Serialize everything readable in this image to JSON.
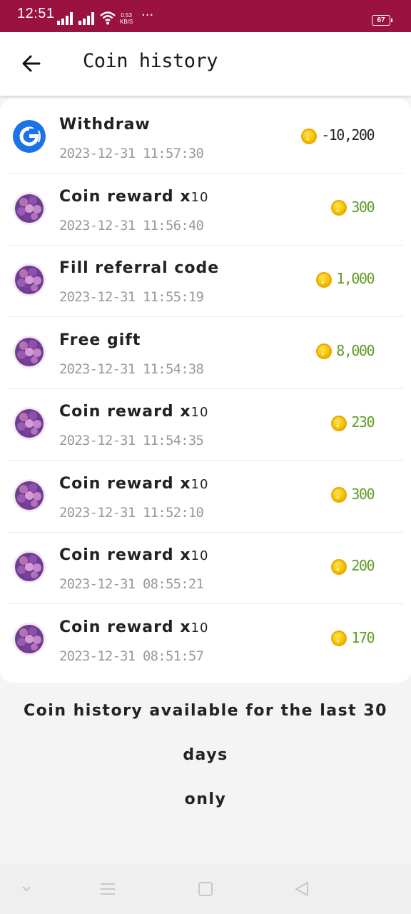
{
  "status_bar": {
    "time": "12:51",
    "net_speed_value": "0.53",
    "net_speed_unit": "KB/S",
    "more": "···",
    "battery": "67"
  },
  "header": {
    "title": "Coin history",
    "back_icon": "arrow-left-icon"
  },
  "items": [
    {
      "title": "Withdraw",
      "suffix": "",
      "date": "2023-12-31  11:57:30",
      "amount": "-10,200",
      "type": "neg",
      "icon": "google-pay-logo"
    },
    {
      "title": "Coin reward x",
      "suffix": "10",
      "date": "2023-12-31  11:56:40",
      "amount": "300",
      "type": "pos",
      "icon": "game-avatar"
    },
    {
      "title": "Fill referral code",
      "suffix": "",
      "date": "2023-12-31  11:55:19",
      "amount": "1,000",
      "type": "pos",
      "icon": "game-avatar"
    },
    {
      "title": "Free gift",
      "suffix": "",
      "date": "2023-12-31  11:54:38",
      "amount": "8,000",
      "type": "pos",
      "icon": "game-avatar"
    },
    {
      "title": "Coin reward x",
      "suffix": "10",
      "date": "2023-12-31  11:54:35",
      "amount": "230",
      "type": "pos",
      "icon": "game-avatar"
    },
    {
      "title": "Coin reward x",
      "suffix": "10",
      "date": "2023-12-31  11:52:10",
      "amount": "300",
      "type": "pos",
      "icon": "game-avatar"
    },
    {
      "title": "Coin reward x",
      "suffix": "10",
      "date": "2023-12-31  08:55:21",
      "amount": "200",
      "type": "pos",
      "icon": "game-avatar"
    },
    {
      "title": "Coin reward x",
      "suffix": "10",
      "date": "2023-12-31  08:51:57",
      "amount": "170",
      "type": "pos",
      "icon": "game-avatar"
    }
  ],
  "footer": {
    "note_line1": "Coin history available for the last 30 days",
    "note_line2": "only"
  },
  "colors": {
    "status_bar": "#9a1240",
    "positive_amount": "#5e9c23",
    "negative_amount": "#222222",
    "coin": "#f7c300"
  }
}
